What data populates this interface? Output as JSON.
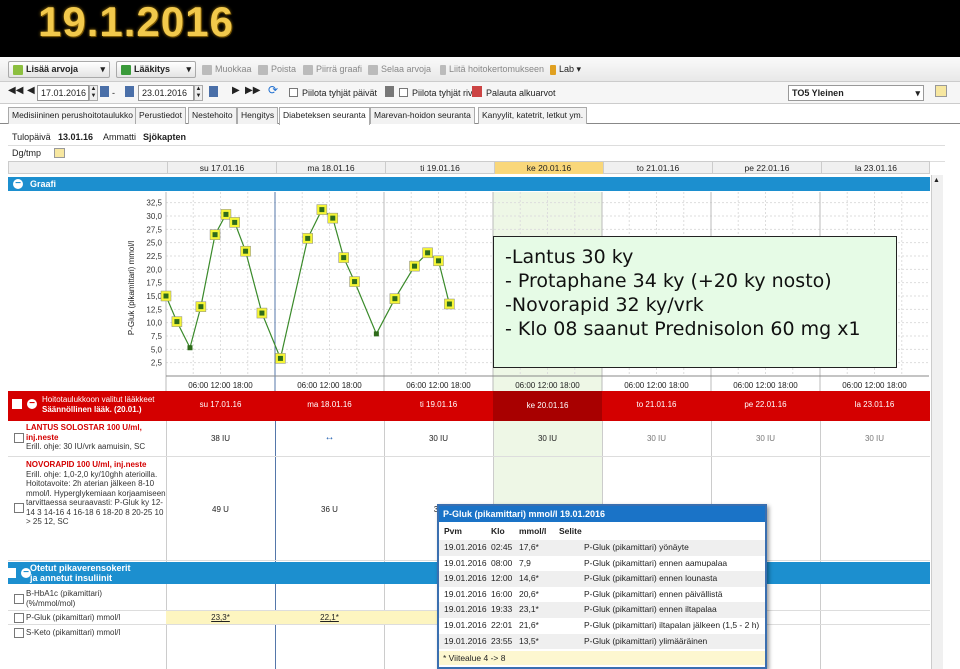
{
  "slide_title": "19.1.2016",
  "toolbar": {
    "add_values": "Lisää arvoja",
    "medication": "Lääkitys",
    "edit": "Muokkaa",
    "delete": "Poista",
    "draw_graph": "Piirrä graafi",
    "browse_values": "Selaa arvoja",
    "attach": "Liitä hoitokertomukseen",
    "lab": "Lab"
  },
  "toolbar2": {
    "date_from": "17.01.2016",
    "date_to": "23.01.2016",
    "hide_empty_days": "Piilota tyhjät päivät",
    "hide_empty_rows": "Piilota tyhjät rivit",
    "restore": "Palauta alkuarvot",
    "unit": "TO5 Yleinen"
  },
  "tabs": [
    "Medisiininen perushoitotaulukko",
    "Perustiedot",
    "Nestehoito",
    "Hengitys",
    "Diabeteksen seuranta",
    "Marevan-hoidon seuranta",
    "Kanyylit, katetrit, letkut ym."
  ],
  "info": {
    "arrival_label": "Tulopäivä",
    "arrival_date": "13.01.16",
    "profession_label": "Ammatti",
    "profession": "Sjökapten",
    "dg_label": "Dg/tmp"
  },
  "days": [
    "su 17.01.16",
    "ma 18.01.16",
    "ti 19.01.16",
    "ke 20.01.16",
    "to 21.01.16",
    "pe 22.01.16",
    "la 23.01.16"
  ],
  "graph_section": "Graafi",
  "time_ticks": "06:00  12:00  18:00",
  "chart_data": {
    "type": "line",
    "ylabel": "P-Gluk (pikamittari) mmol/l",
    "ylim": [
      0,
      33
    ],
    "yticks": [
      "32,5",
      "30,0",
      "27,5",
      "25,0",
      "22,5",
      "20,0",
      "17,5",
      "15,0",
      "12,5",
      "10,0",
      "7,5",
      "5,0",
      "2,5"
    ],
    "points": [
      [
        0.0,
        15.0
      ],
      [
        0.1,
        10.2
      ],
      [
        0.22,
        5.3
      ],
      [
        0.32,
        13.0
      ],
      [
        0.45,
        26.5
      ],
      [
        0.55,
        30.3
      ],
      [
        0.63,
        28.8
      ],
      [
        0.73,
        23.4
      ],
      [
        0.88,
        11.8
      ],
      [
        1.05,
        3.3
      ],
      [
        1.3,
        25.8
      ],
      [
        1.43,
        31.2
      ],
      [
        1.53,
        29.6
      ],
      [
        1.63,
        22.2
      ],
      [
        1.73,
        17.7
      ],
      [
        1.93,
        7.9
      ],
      [
        2.1,
        14.5
      ],
      [
        2.28,
        20.6
      ],
      [
        2.4,
        23.1
      ],
      [
        2.5,
        21.6
      ],
      [
        2.6,
        13.5
      ]
    ]
  },
  "med_section": {
    "line1": "Hoitotaulukkoon valitut lääkkeet",
    "line2": "Säännöllinen lääk. (20.01.)"
  },
  "meds": [
    {
      "name": "LANTUS SOLOSTAR 100 U/ml, inj.neste",
      "instr": "Erill. ohje: 30 IU/vrk aamuisin, SC",
      "doses": [
        "38 IU",
        "↔",
        "30 IU",
        "30 IU",
        "30 IU",
        "30 IU",
        "30 IU"
      ]
    },
    {
      "name": "NOVORAPID 100 U/ml, inj.neste",
      "instr": "Erill. ohje: 1,0-2,0 ky/10ghh aterioilla. Hoitotavoite: 2h aterian jälkeen 8-10 mmol/l. Hyperglykemiaan korjaamiseen tarvittaessa seuraavasti: P-Gluk ky 12-14 3 14-16 4 16-18 6 18-20 8 20-25 10 > 25 12, SC",
      "doses": [
        "49 U",
        "36 U",
        "3"
      ]
    }
  ],
  "samples_section": {
    "line1": "Otetut pikaverensokerit",
    "line2": "ja annetut insuliinit"
  },
  "samples": [
    {
      "name": "B-HbA1c (pikamittari) (%/mmol/mol)"
    },
    {
      "name": "P-Gluk (pikamittari) mmol/l",
      "vals": [
        "23,3*",
        "22,1*",
        "1"
      ]
    },
    {
      "name": "S-Keto (pikamittari) mmol/l"
    }
  ],
  "callout": [
    "-Lantus 30 ky",
    "- Protaphane 34 ky (+20 ky nosto)",
    "-Novorapid 32 ky/vrk",
    "- Klo 08 saanut Prednisolon 60 mg x1"
  ],
  "popup": {
    "title": "P-Gluk (pikamittari) mmol/l 19.01.2016",
    "headers": [
      "Pvm",
      "Klo",
      "mmol/l",
      "Selite"
    ],
    "rows": [
      [
        "19.01.2016",
        "02:45",
        "17,6*",
        "P-Gluk (pikamittari) yönäyte"
      ],
      [
        "19.01.2016",
        "08:00",
        "7,9",
        "P-Gluk (pikamittari) ennen aamupalaa"
      ],
      [
        "19.01.2016",
        "12:00",
        "14,6*",
        "P-Gluk (pikamittari) ennen lounasta"
      ],
      [
        "19.01.2016",
        "16:00",
        "20,6*",
        "P-Gluk (pikamittari) ennen päivällistä"
      ],
      [
        "19.01.2016",
        "19:33",
        "23,1*",
        "P-Gluk (pikamittari) ennen iltapalaa"
      ],
      [
        "19.01.2016",
        "22:01",
        "21,6*",
        "P-Gluk (pikamittari) iltapalan jälkeen (1,5 - 2 h)"
      ],
      [
        "19.01.2016",
        "23:55",
        "13,5*",
        "P-Gluk (pikamittari) ylimääräinen"
      ]
    ],
    "footer": "* Viitealue 4 -> 8"
  }
}
